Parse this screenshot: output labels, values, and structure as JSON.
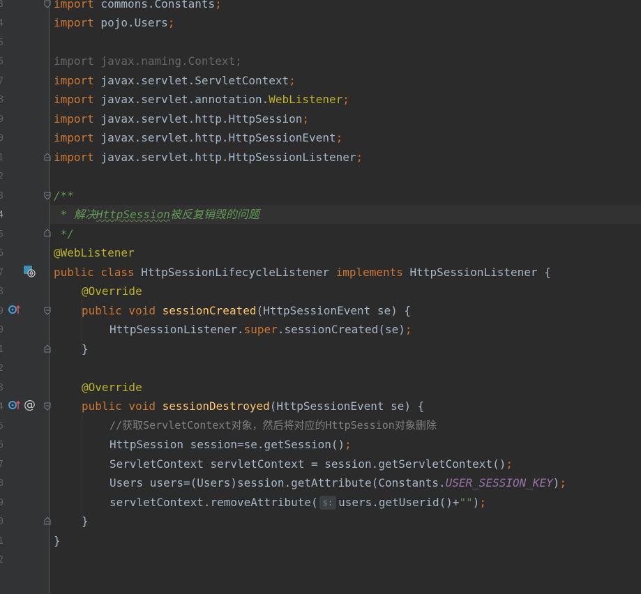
{
  "editor": {
    "line_numbers": [
      "3",
      "4",
      "5",
      "6",
      "7",
      "8",
      "9",
      "0",
      "1",
      "2",
      "3",
      "4",
      "5",
      "6",
      "7",
      "8",
      "9",
      "0",
      "1",
      "2",
      "3",
      "4",
      "5",
      "6",
      "7",
      "8",
      "9",
      "0",
      "1",
      "2"
    ],
    "code": {
      "l1_kw": "import",
      "l1_rest": " commons.Constants",
      "l2_kw": "import",
      "l2_rest": " pojo.Users",
      "l3": "import javax.naming.Context;",
      "l4_kw": "import",
      "l4_rest": " javax.servlet.ServletContext",
      "l5_kw": "import",
      "l5_rest": " javax.servlet.annotation.",
      "l5_ann": "WebListener",
      "l6_kw": "import",
      "l6_rest": " javax.servlet.http.HttpSession",
      "l7_kw": "import",
      "l7_rest": " javax.servlet.http.HttpSessionEvent",
      "l8_kw": "import",
      "l8_rest": " javax.servlet.http.HttpSessionListener",
      "semi": ";",
      "doc_open": "/**",
      "doc_line_prefix": " * 解决",
      "doc_link": "HttpSession",
      "doc_line_suffix": "被反复销毁的问题",
      "doc_close": " */",
      "annotation_weblistener": "@WebListener",
      "class_kw1": "public class",
      "class_name": " HttpSessionLifecycleListener ",
      "class_kw2": "implements",
      "class_iface": " HttpSessionListener {",
      "override": "@Override",
      "method_kw": "public void",
      "method1_name": "sessionCreated",
      "method1_params": "(HttpSessionEvent se) {",
      "super_prefix": "HttpSessionListener.",
      "super_kw": "super",
      "super_call": ".sessionCreated(se)",
      "close_brace": "}",
      "method2_name": "sessionDestroyed",
      "method2_params": "(HttpSessionEvent se) {",
      "comment_line": "//获取ServletContext对象，然后将对应的HttpSession对象删除",
      "stmt1": "HttpSession session=se.getSession()",
      "stmt2": "ServletContext servletContext = session.getServletContext()",
      "stmt3_prefix": "Users users=(Users)session.getAttribute(Constants.",
      "stmt3_const": "USER_SESSION_KEY",
      "stmt3_suffix": ")",
      "stmt4_prefix": "servletContext.removeAttribute(",
      "stmt4_hint": "s:",
      "stmt4_mid": "users.getUserid()+",
      "stmt4_str": "\"\"",
      "stmt4_suffix": ")",
      "final_brace": "}"
    }
  },
  "colors": {
    "background": "#2b2b2b",
    "gutter": "#313335",
    "keyword": "#cc7832",
    "annotation": "#bbb529",
    "method": "#ffc66d",
    "doc_comment": "#629755",
    "comment": "#808080",
    "constant": "#9876aa",
    "text": "#a9b7c6"
  }
}
